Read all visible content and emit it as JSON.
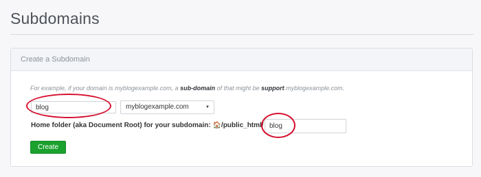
{
  "page": {
    "title": "Subdomains"
  },
  "panel": {
    "heading": "Create a Subdomain",
    "help": {
      "prefix": "For example, if your domain is myblogexample.com, a ",
      "emph1": "sub-domain",
      "middle": " of that might be ",
      "emph2": "support",
      "suffix": ".myblogexample.com."
    },
    "subdomain_value": "blog",
    "separator": ".",
    "domain_selected": "myblogexample.com",
    "docroot_label": "Home folder (aka Document Root) for your subdomain: 🏠/public_html/",
    "docroot_value": "blog",
    "create_label": "Create"
  },
  "colors": {
    "accent_green": "#1ba12e",
    "highlight_red": "#d6102f"
  }
}
